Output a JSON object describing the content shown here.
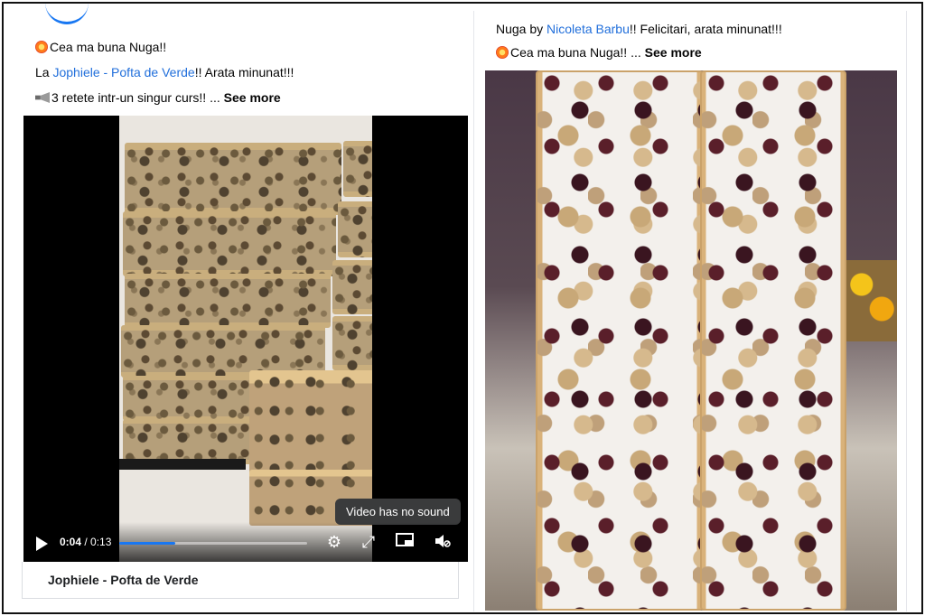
{
  "left_post": {
    "line1_text": "Cea ma buna Nuga!!",
    "line2_prefix": "La ",
    "line2_link": "Jophiele - Pofta de Verde",
    "line2_suffix": "!! Arata minunat!!!",
    "line3_text": "3 retete intr-un singur curs!! ... ",
    "see_more": "See more",
    "video": {
      "current_time": "0:04",
      "duration": " / 0:13",
      "progress_fraction": 0.3,
      "tooltip": "Video has no sound"
    },
    "page_name": "Jophiele - Pofta de Verde"
  },
  "right_post": {
    "line1_prefix": "Nuga by ",
    "line1_link": "Nicoleta Barbu",
    "line1_suffix": "!! Felicitari, arata minunat!!!",
    "line2_text": "Cea ma buna Nuga!! ... ",
    "see_more": "See more"
  },
  "colors": {
    "link": "#216fdb",
    "progress": "#1877f2"
  },
  "icons": [
    "burst-emoji-icon",
    "megaphone-emoji-icon",
    "play-icon",
    "settings-gear-icon",
    "fullscreen-icon",
    "picture-in-picture-icon",
    "muted-speaker-icon"
  ]
}
